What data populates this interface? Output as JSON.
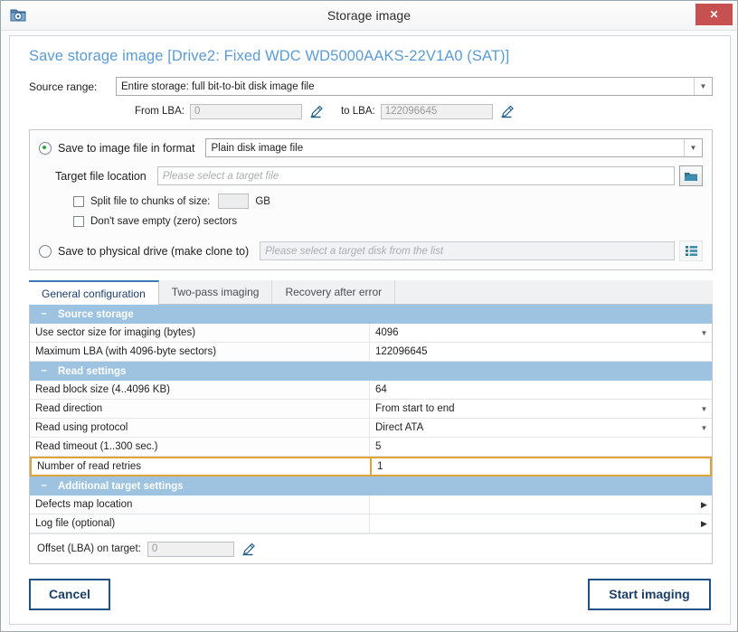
{
  "window": {
    "title": "Storage image",
    "app_icon": "disk-folder-icon",
    "close_label": "✕"
  },
  "page": {
    "title": "Save storage image [Drive2: Fixed WDC WD5000AAKS-22V1A0 (SAT)]"
  },
  "source_range": {
    "label": "Source range:",
    "value": "Entire storage: full bit-to-bit disk image file",
    "from_label": "From LBA:",
    "from_value": "0",
    "to_label": "to LBA:",
    "to_value": "122096645",
    "edit_icon": "pencil-icon"
  },
  "target": {
    "save_image_label": "Save to image file in format",
    "save_image_selected": true,
    "format_value": "Plain disk image file",
    "target_file_label": "Target file location",
    "target_file_placeholder": "Please select a target file",
    "browse_icon": "open-folder-icon",
    "split_label": "Split file to chunks of size:",
    "split_checked": false,
    "split_value": "",
    "split_unit": "GB",
    "skip_empty_label": "Don't save empty (zero) sectors",
    "skip_empty_checked": false,
    "clone_label": "Save to physical drive (make clone to)",
    "clone_selected": false,
    "clone_placeholder": "Please select a target disk from the list",
    "clone_icon": "list-icon"
  },
  "tabs": [
    {
      "label": "General configuration",
      "active": true
    },
    {
      "label": "Two-pass imaging",
      "active": false
    },
    {
      "label": "Recovery after error",
      "active": false
    }
  ],
  "sections": [
    {
      "title": "Source storage",
      "collapse_glyph": "–",
      "rows": [
        {
          "name": "Use sector size for imaging (bytes)",
          "value": "4096",
          "arrow": "down"
        },
        {
          "name": "Maximum LBA (with 4096-byte sectors)",
          "value": "122096645",
          "arrow": "none"
        }
      ]
    },
    {
      "title": "Read settings",
      "collapse_glyph": "–",
      "rows": [
        {
          "name": "Read block size (4..4096 KB)",
          "value": "64",
          "arrow": "none"
        },
        {
          "name": "Read direction",
          "value": "From start to end",
          "arrow": "down"
        },
        {
          "name": "Read using protocol",
          "value": "Direct ATA",
          "arrow": "down"
        },
        {
          "name": "Read timeout (1..300 sec.)",
          "value": "5",
          "arrow": "none"
        },
        {
          "name": "Number of read retries",
          "value": "1",
          "arrow": "none",
          "focused": true
        }
      ]
    },
    {
      "title": "Additional target settings",
      "collapse_glyph": "–",
      "rows": [
        {
          "name": "Defects map location",
          "value": "",
          "arrow": "right"
        },
        {
          "name": "Log file (optional)",
          "value": "",
          "arrow": "right"
        }
      ]
    }
  ],
  "offset": {
    "label": "Offset (LBA) on target:",
    "value": "0",
    "edit_icon": "pencil-icon"
  },
  "footer": {
    "cancel_label": "Cancel",
    "start_label": "Start imaging"
  },
  "colors": {
    "accent": "#5b9bd5",
    "section_header": "#9dc3e0",
    "button_border": "#215182",
    "close_button": "#c75151",
    "focus_border": "#e0a33a",
    "radio_dot": "#2fa33a"
  }
}
